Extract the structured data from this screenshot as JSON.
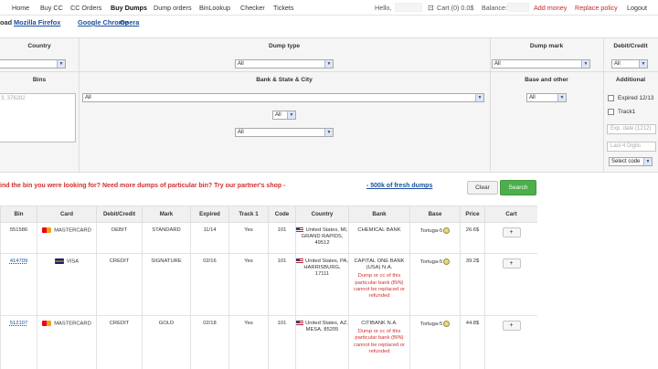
{
  "nav": {
    "home": "Home",
    "buy_cc": "Buy CC",
    "cc_orders": "CC Orders",
    "buy_dumps": "Buy Dumps",
    "dump_orders": "Dump orders",
    "binlookup": "BinLookup",
    "checker": "Checker",
    "tickets": "Tickets",
    "hello": "Hello,",
    "cart": "Cart (0) 0.0$",
    "balance": "Balance:",
    "add_money": "Add money",
    "replace_policy": "Replace policy",
    "logout": "Logout"
  },
  "browser_line": {
    "prefix": "oad",
    "firefox": "Mozilla Firefox",
    "chrome": "Google Chrome",
    "opera": "Opera"
  },
  "filters": {
    "country_label": "Country",
    "dump_type_label": "Dump type",
    "dump_mark_label": "Dump mark",
    "debit_credit_label": "Debit/Credit",
    "bins_label": "Bins",
    "bank_label": "Bank & State & City",
    "base_label": "Base and other",
    "additional_label": "Additional",
    "dump_type_value": "All",
    "dump_mark_value": "All",
    "debit_credit_value": "All",
    "bins_placeholder": "3, 376282",
    "bank_value": "All",
    "state_value": "All",
    "city_value": "All",
    "base_value": "All",
    "expired_label": "Expired 12/13",
    "track1_label": "Track1",
    "exp_date_placeholder": "Exp. date (1212)",
    "last4_placeholder": "Last 4 Digits",
    "select_code_value": "Select code"
  },
  "promo": {
    "text": "ind the bin you were looking for? Need more dumps of particular bin? Try our partner's shop -",
    "link": "- 500k of fresh dumps",
    "clear": "Clear",
    "search": "Search"
  },
  "table": {
    "headers": [
      "Bin",
      "Card",
      "Debit/Credit",
      "Mark",
      "Expired",
      "Track 1",
      "Code",
      "Country",
      "Bank",
      "Base",
      "Price",
      "Cart"
    ],
    "rows": [
      {
        "bin": "551586",
        "card": "MASTERCARD",
        "card_icon": "mastercard-icon",
        "type": "DEBIT",
        "mark": "STANDARD",
        "expired": "11/14",
        "track1": "Yes",
        "code": "101",
        "country": "United States, MI, GRAND RAPIDS, 49512",
        "bank": "CHEMICAL BANK",
        "note": "",
        "base": "Tortuga-5",
        "price": "26.6$",
        "cart": "+"
      },
      {
        "bin": "414709",
        "card": "VISA",
        "card_icon": "visa-icon",
        "type": "CREDIT",
        "mark": "SIGNATURE",
        "expired": "02/16",
        "track1": "Yes",
        "code": "101",
        "country": "United States, PA, HARRISBURG, 17111",
        "bank": "CAPITAL ONE BANK (USA) N.A.",
        "note": "Dump or cc of this particular bank (BIN) cannot be replaced or refunded",
        "base": "Tortuga-5",
        "price": "39.2$",
        "cart": "+"
      },
      {
        "bin": "512107",
        "card": "MASTERCARD",
        "card_icon": "mastercard-icon",
        "type": "CREDIT",
        "mark": "GOLD",
        "expired": "02/18",
        "track1": "Yes",
        "code": "101",
        "country": "United States, AZ, MESA, 85205",
        "bank": "CITIBANK N.A.",
        "note": "Dump or cc of this particular bank (BIN) cannot be replaced or refunded",
        "base": "Tortuga-5",
        "price": "44.8$",
        "cart": "+"
      }
    ]
  }
}
